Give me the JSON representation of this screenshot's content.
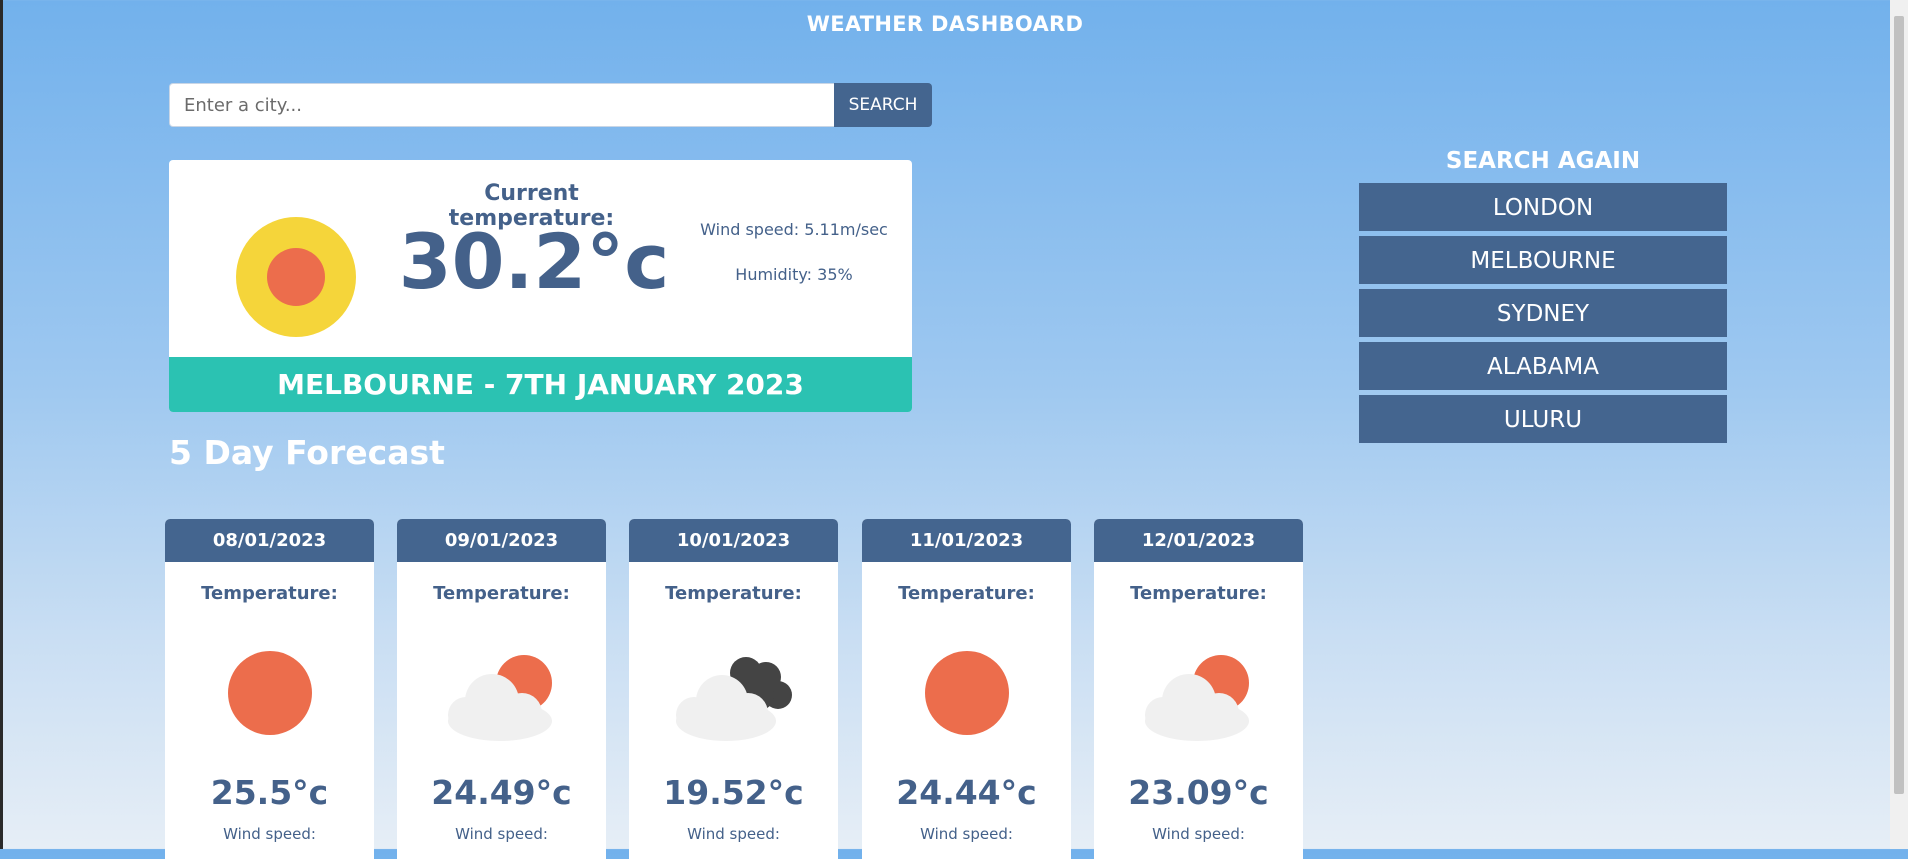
{
  "header": {
    "title": "WEATHER DASHBOARD"
  },
  "search": {
    "placeholder": "Enter a city...",
    "button_label": "SEARCH"
  },
  "current": {
    "label": "Current temperature:",
    "temperature": "30.2°c",
    "wind": "Wind speed: 5.11m/sec",
    "humidity": "Humidity: 35%",
    "city_date": "MELBOURNE - 7TH JANUARY 2023",
    "icon": "sun-icon"
  },
  "forecast": {
    "heading": "5 Day Forecast",
    "days": [
      {
        "date": "08/01/2023",
        "label": "Temperature:",
        "temp": "25.5°c",
        "wind": "Wind speed:",
        "icon": "sun-icon"
      },
      {
        "date": "09/01/2023",
        "label": "Temperature:",
        "temp": "24.49°c",
        "wind": "Wind speed:",
        "icon": "partly-cloudy-icon"
      },
      {
        "date": "10/01/2023",
        "label": "Temperature:",
        "temp": "19.52°c",
        "wind": "Wind speed:",
        "icon": "cloudy-icon"
      },
      {
        "date": "11/01/2023",
        "label": "Temperature:",
        "temp": "24.44°c",
        "wind": "Wind speed:",
        "icon": "sun-icon"
      },
      {
        "date": "12/01/2023",
        "label": "Temperature:",
        "temp": "23.09°c",
        "wind": "Wind speed:",
        "icon": "partly-cloudy-icon"
      }
    ]
  },
  "history": {
    "title": "SEARCH AGAIN",
    "cities": [
      "LONDON",
      "MELBOURNE",
      "SYDNEY",
      "ALABAMA",
      "ULURU"
    ]
  },
  "colors": {
    "accent": "#44658f",
    "teal": "#2bc2b2",
    "sun_orange": "#ec6d4c",
    "sun_yellow": "#f5d53a",
    "cloud": "#f0f0f0",
    "dark_cloud": "#444444"
  }
}
